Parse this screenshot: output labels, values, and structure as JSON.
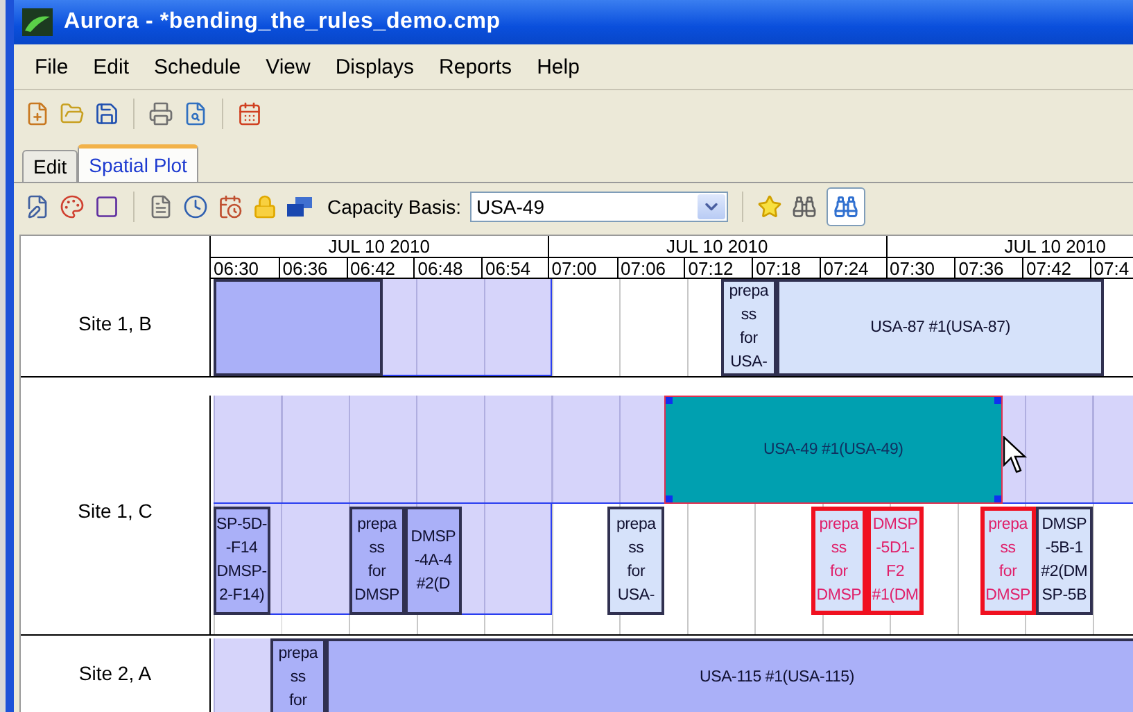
{
  "window": {
    "title": "Aurora - *bending_the_rules_demo.cmp"
  },
  "menu": [
    "File",
    "Edit",
    "Schedule",
    "View",
    "Displays",
    "Reports",
    "Help"
  ],
  "tabs": [
    {
      "label": "Edit",
      "selected": false
    },
    {
      "label": "Spatial Plot",
      "selected": true
    }
  ],
  "capacity_basis": {
    "label": "Capacity Basis:",
    "value": "USA-49"
  },
  "timeline": [
    {
      "date": "JUL 10 2010",
      "times": [
        "06:30",
        "06:36",
        "06:42",
        "06:48",
        "06:54"
      ]
    },
    {
      "date": "JUL 10 2010",
      "times": [
        "07:00",
        "07:06",
        "07:12",
        "07:18",
        "07:24"
      ]
    },
    {
      "date": "JUL 10 2010",
      "times": [
        "07:30",
        "07:36",
        "07:42",
        "07:4"
      ]
    }
  ],
  "rows": [
    {
      "site": "Site 1, B",
      "blocks": [
        {
          "kind": "dark",
          "selected": false,
          "conflict": false
        },
        {
          "kind": "light",
          "lines": [
            "prepa",
            "ss",
            "for",
            "USA-"
          ],
          "selected": false,
          "conflict": false
        },
        {
          "kind": "light",
          "lines": [
            "USA-87 #1(USA-87)"
          ],
          "selected": false,
          "conflict": false
        }
      ]
    },
    {
      "site": "Site 1, C",
      "blocks": [
        {
          "kind": "teal",
          "lines": [
            "USA-49 #1(USA-49)"
          ],
          "selected": true,
          "conflict": false
        },
        {
          "kind": "dark",
          "lines": [
            "SP-5D-",
            "-F14",
            "DMSP-",
            "2-F14)"
          ],
          "selected": false,
          "conflict": false
        },
        {
          "kind": "dark",
          "lines": [
            "prepa",
            "ss",
            "for",
            "DMSP"
          ],
          "selected": false,
          "conflict": false
        },
        {
          "kind": "dark",
          "lines": [
            "DMSP",
            "-4A-4",
            "#2(D"
          ],
          "selected": false,
          "conflict": false
        },
        {
          "kind": "light",
          "lines": [
            "prepa",
            "ss",
            "for",
            "USA-"
          ],
          "selected": false,
          "conflict": false
        },
        {
          "kind": "light",
          "lines": [
            "prepa",
            "ss",
            "for",
            "DMSP"
          ],
          "selected": false,
          "conflict": true
        },
        {
          "kind": "light",
          "lines": [
            "DMSP",
            "-5D1-",
            "F2",
            "#1(DM"
          ],
          "selected": false,
          "conflict": true
        },
        {
          "kind": "light",
          "lines": [
            "prepa",
            "ss",
            "for",
            "DMSP"
          ],
          "selected": false,
          "conflict": true
        },
        {
          "kind": "light",
          "lines": [
            "DMSP",
            "-5B-1",
            "#2(DM",
            "SP-5B"
          ],
          "selected": false,
          "conflict": false
        }
      ]
    },
    {
      "site": "Site 2, A",
      "blocks": [
        {
          "kind": "dark",
          "lines": [
            "prepa",
            "ss",
            "for"
          ],
          "selected": false,
          "conflict": false
        },
        {
          "kind": "dark",
          "lines": [
            "USA-115 #1(USA-115)"
          ],
          "selected": false,
          "conflict": false
        }
      ]
    }
  ]
}
